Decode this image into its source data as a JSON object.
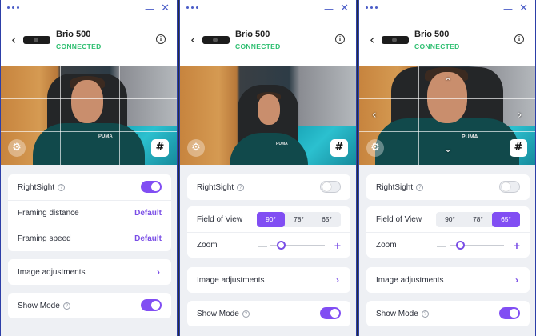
{
  "device": {
    "name": "Brio 500",
    "status": "CONNECTED"
  },
  "window_controls": {
    "minimize": "—",
    "close": "✕"
  },
  "preview": {
    "shirt_logo": "PUMA"
  },
  "panels": [
    {
      "rightsight": {
        "label": "RightSight",
        "enabled": true
      },
      "framing_distance": {
        "label": "Framing distance",
        "value": "Default"
      },
      "framing_speed": {
        "label": "Framing speed",
        "value": "Default"
      },
      "image_adjustments": {
        "label": "Image adjustments"
      },
      "show_mode": {
        "label": "Show Mode",
        "enabled": true
      }
    },
    {
      "rightsight": {
        "label": "RightSight",
        "enabled": false
      },
      "fov": {
        "label": "Field of View",
        "options": [
          "90°",
          "78°",
          "65°"
        ],
        "selected": "90°"
      },
      "zoom": {
        "label": "Zoom",
        "minus": "—",
        "plus": "+",
        "level": 0.1
      },
      "image_adjustments": {
        "label": "Image adjustments"
      },
      "show_mode": {
        "label": "Show Mode",
        "enabled": true
      }
    },
    {
      "rightsight": {
        "label": "RightSight",
        "enabled": false
      },
      "fov": {
        "label": "Field of View",
        "options": [
          "90°",
          "78°",
          "65°"
        ],
        "selected": "65°"
      },
      "zoom": {
        "label": "Zoom",
        "minus": "—",
        "plus": "+",
        "level": 0.1
      },
      "image_adjustments": {
        "label": "Image adjustments"
      },
      "show_mode": {
        "label": "Show Mode",
        "enabled": true
      }
    }
  ],
  "colors": {
    "accent": "#814ef3",
    "connected": "#2fbf71"
  }
}
